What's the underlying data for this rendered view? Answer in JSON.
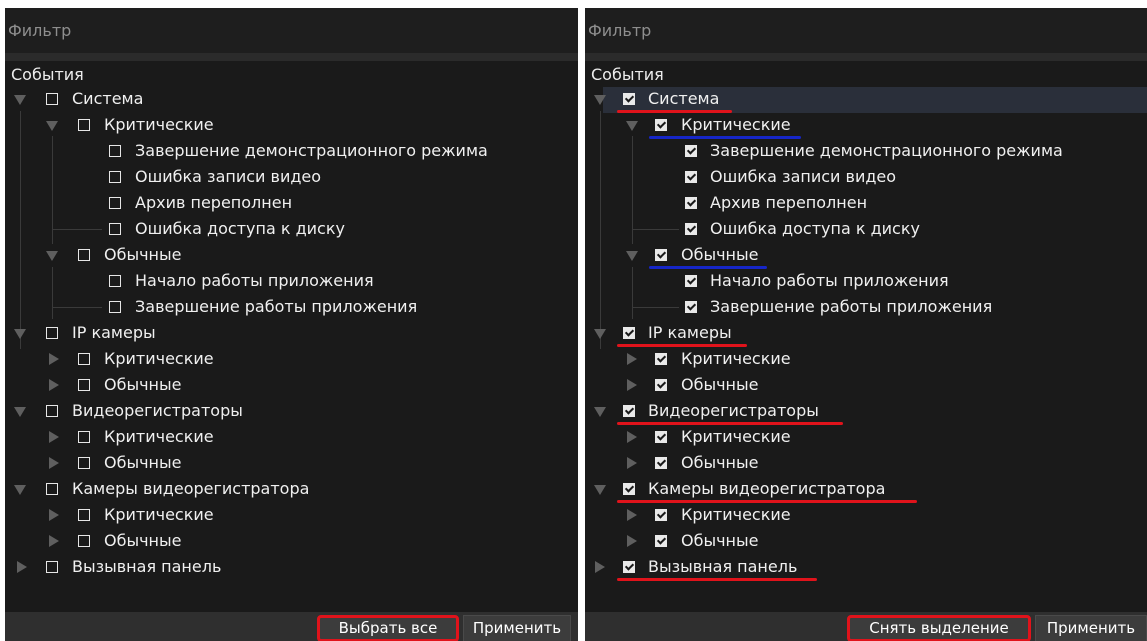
{
  "left": {
    "title": "Фильтр",
    "section": "События",
    "rows": [
      "Система",
      "Критические",
      "Завершение демонстрационного режима",
      "Ошибка записи видео",
      "Архив переполнен",
      "Ошибка доступа к диску",
      "Обычные",
      "Начало работы приложения",
      "Завершение работы приложения",
      "IP камеры",
      "Критические",
      "Обычные",
      "Видеорегистраторы",
      "Критические",
      "Обычные",
      "Камеры видеорегистратора",
      "Критические",
      "Обычные",
      "Вызывная панель"
    ],
    "checked": false,
    "buttons": {
      "select_all": "Выбрать все",
      "apply": "Применить"
    }
  },
  "right": {
    "title": "Фильтр",
    "section": "События",
    "rows": [
      "Система",
      "Критические",
      "Завершение демонстрационного режима",
      "Ошибка записи видео",
      "Архив переполнен",
      "Ошибка доступа к диску",
      "Обычные",
      "Начало работы приложения",
      "Завершение работы приложения",
      "IP камеры",
      "Критические",
      "Обычные",
      "Видеорегистраторы",
      "Критические",
      "Обычные",
      "Камеры видеорегистратора",
      "Критические",
      "Обычные",
      "Вызывная панель"
    ],
    "checked": true,
    "buttons": {
      "deselect": "Снять выделение",
      "apply": "Применить"
    }
  },
  "colors": {
    "annotation_red": "#e0131b",
    "annotation_blue": "#1626c8",
    "panel_bg": "#1a1a1a"
  }
}
